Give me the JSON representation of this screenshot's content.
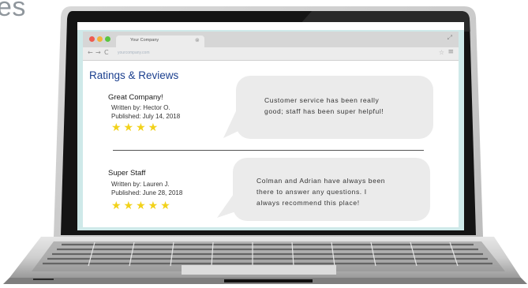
{
  "page": {
    "title_fragment": "es"
  },
  "browser": {
    "tab_title": "Your Company",
    "url": "yourcompany.com"
  },
  "content": {
    "heading": "Ratings & Reviews",
    "reviews": [
      {
        "title": "Great Company!",
        "author": "Written by: Hector O.",
        "published": "Published: July 14, 2018",
        "stars": "★★★★",
        "rating": 4,
        "text_lines": [
          "Customer service has been really",
          "good; staff has been super helpful!"
        ]
      },
      {
        "title": "Super Staff",
        "author": "Written by: Lauren J.",
        "published": "Published: June 28, 2018",
        "stars": "★★★★★",
        "rating": 5,
        "text_lines": [
          "Colman and Adrian have always been",
          "there to answer any questions. I",
          "always recommend this place!"
        ]
      }
    ]
  },
  "colors": {
    "heading": "#1b3f8e",
    "star": "#f2d21a",
    "bubble": "#ebebeb",
    "bezel": "#141414",
    "screen_bg": "#cfe9e9"
  }
}
